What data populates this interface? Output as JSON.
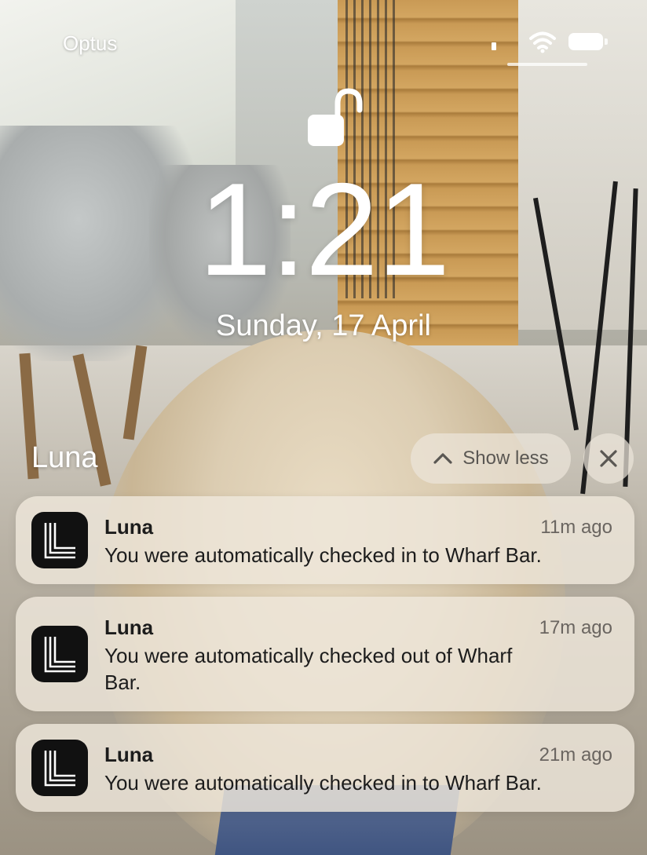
{
  "status_bar": {
    "carrier": "Optus"
  },
  "lock_screen": {
    "time": "1:21",
    "date": "Sunday, 17 April"
  },
  "group": {
    "title": "Luna",
    "show_less_label": "Show less"
  },
  "notifications": [
    {
      "app": "Luna",
      "time": "11m ago",
      "message": "You were automatically checked in to Wharf Bar."
    },
    {
      "app": "Luna",
      "time": "17m ago",
      "message": "You were automatically checked out of Wharf Bar."
    },
    {
      "app": "Luna",
      "time": "21m ago",
      "message": "You were automatically checked in to Wharf Bar."
    }
  ],
  "icons": {
    "lock": "unlocked-padlock-icon",
    "signal": "cellular-signal-icon",
    "wifi": "wifi-icon",
    "battery": "battery-icon",
    "show_less": "chevron-up-icon",
    "close": "close-icon",
    "app": "luna-app-icon"
  },
  "colors": {
    "notification_bg": "#eee6db",
    "app_icon_bg": "#111111",
    "text_primary": "#1c1c1c",
    "text_secondary": "#6a6560"
  }
}
